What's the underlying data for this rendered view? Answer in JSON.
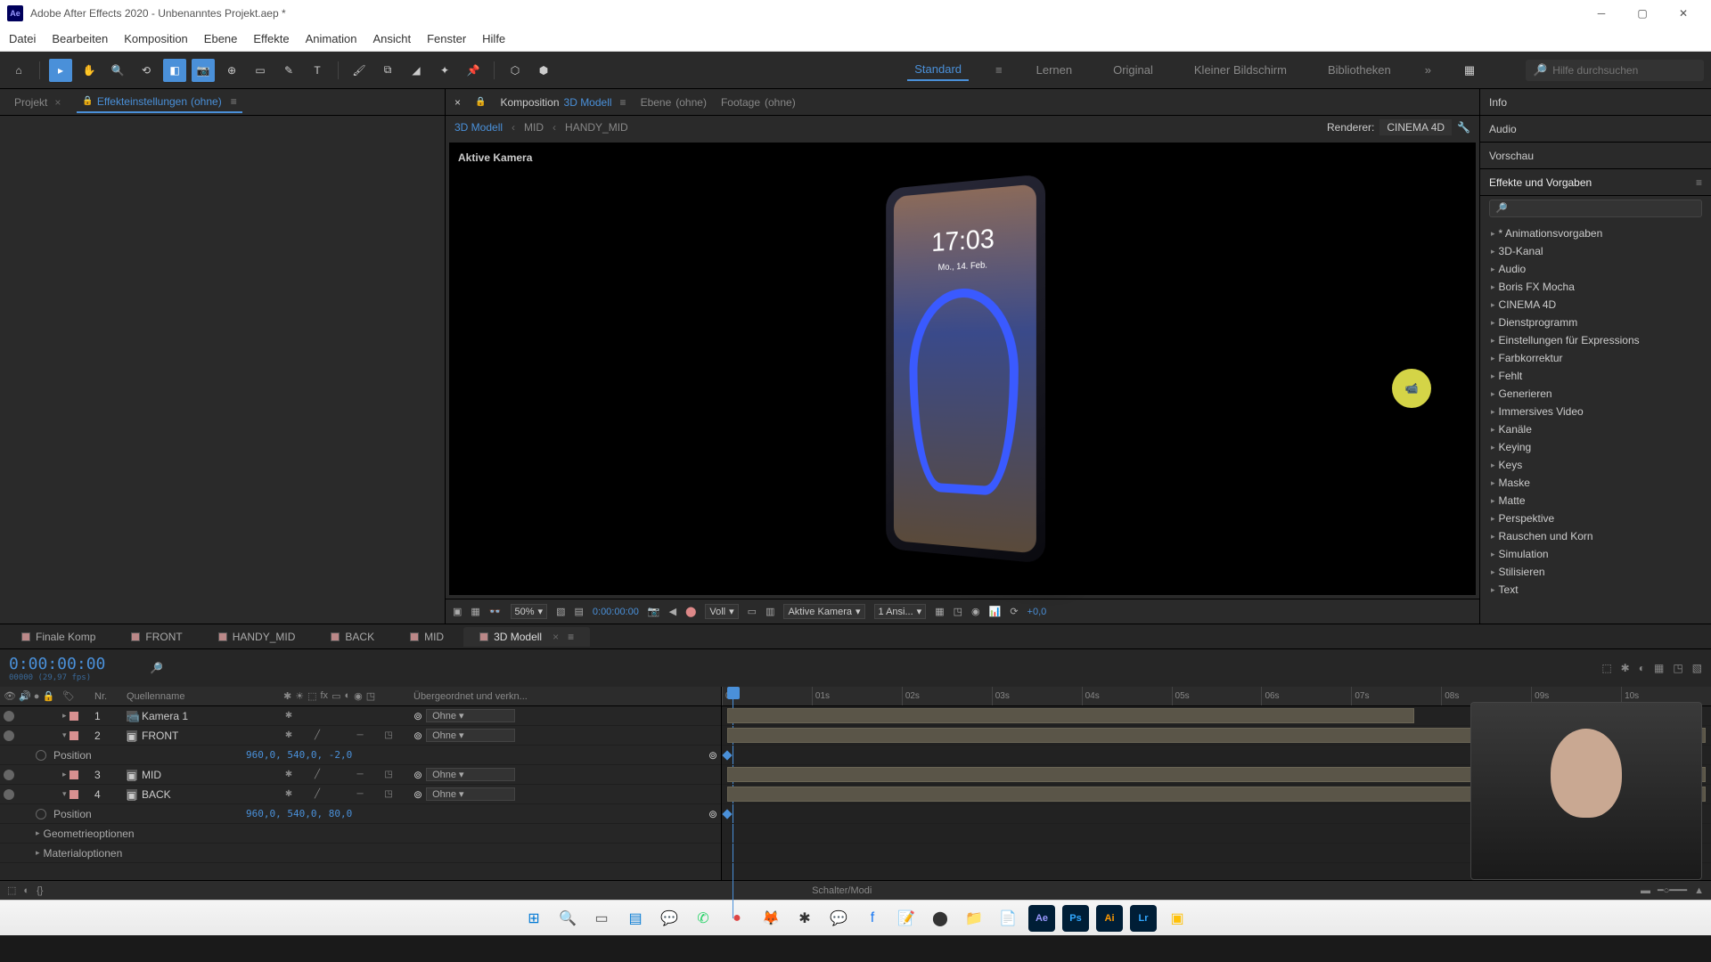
{
  "titlebar": {
    "app": "Adobe After Effects 2020",
    "project": "Unbenanntes Projekt.aep *"
  },
  "menu": [
    "Datei",
    "Bearbeiten",
    "Komposition",
    "Ebene",
    "Effekte",
    "Animation",
    "Ansicht",
    "Fenster",
    "Hilfe"
  ],
  "workspaces": {
    "items": [
      "Standard",
      "Lernen",
      "Original",
      "Kleiner Bildschirm",
      "Bibliotheken"
    ],
    "active": "Standard"
  },
  "search": {
    "placeholder": "Hilfe durchsuchen"
  },
  "left_panel": {
    "tabs": [
      {
        "label": "Projekt",
        "active": false
      },
      {
        "label": "Effekteinstellungen",
        "suffix": "(ohne)",
        "active": true,
        "locked": true
      }
    ]
  },
  "composition": {
    "tabs": [
      {
        "label": "Komposition",
        "sub": "3D Modell",
        "active": true,
        "locked": true
      },
      {
        "label": "Ebene",
        "sub": "(ohne)"
      },
      {
        "label": "Footage",
        "sub": "(ohne)"
      }
    ],
    "breadcrumb": [
      "3D Modell",
      "MID",
      "HANDY_MID"
    ],
    "renderer_label": "Renderer:",
    "renderer_value": "CINEMA 4D",
    "camera_label": "Aktive Kamera",
    "phone_time": "17:03",
    "phone_date": "Mo., 14. Feb.",
    "footer": {
      "zoom": "50%",
      "time": "0:00:00:00",
      "resolution": "Voll",
      "camera": "Aktive Kamera",
      "views": "1 Ansi...",
      "exposure": "+0,0"
    }
  },
  "right_panel": {
    "sections": [
      "Info",
      "Audio",
      "Vorschau",
      "Effekte und Vorgaben"
    ],
    "effects": [
      "* Animationsvorgaben",
      "3D-Kanal",
      "Audio",
      "Boris FX Mocha",
      "CINEMA 4D",
      "Dienstprogramm",
      "Einstellungen für Expressions",
      "Farbkorrektur",
      "Fehlt",
      "Generieren",
      "Immersives Video",
      "Kanäle",
      "Keying",
      "Keys",
      "Maske",
      "Matte",
      "Perspektive",
      "Rauschen und Korn",
      "Simulation",
      "Stilisieren",
      "Text"
    ]
  },
  "timeline": {
    "tabs": [
      "Finale Komp",
      "FRONT",
      "HANDY_MID",
      "BACK",
      "MID",
      "3D Modell"
    ],
    "active_tab": "3D Modell",
    "timecode": "0:00:00:00",
    "timecode_sub": "00000 (29,97 fps)",
    "columns": {
      "num": "Nr.",
      "name": "Quellenname",
      "parent": "Übergeordnet und verkn..."
    },
    "layers": [
      {
        "num": 1,
        "name": "Kamera 1",
        "type": "camera",
        "parent": "Ohne"
      },
      {
        "num": 2,
        "name": "FRONT",
        "type": "comp",
        "parent": "Ohne",
        "expanded": true,
        "props": [
          {
            "name": "Position",
            "value": "960,0, 540,0, -2,0"
          }
        ]
      },
      {
        "num": 3,
        "name": "MID",
        "type": "comp",
        "parent": "Ohne"
      },
      {
        "num": 4,
        "name": "BACK",
        "type": "comp",
        "parent": "Ohne",
        "expanded": true,
        "props": [
          {
            "name": "Position",
            "value": "960,0, 540,0, 80,0"
          },
          {
            "name": "Geometrieoptionen",
            "expandable": true
          },
          {
            "name": "Materialoptionen",
            "expandable": true
          }
        ]
      }
    ],
    "parent_none": "Ohne",
    "ruler": [
      "00s",
      "01s",
      "02s",
      "03s",
      "04s",
      "05s",
      "06s",
      "07s",
      "08s",
      "09s",
      "10s"
    ],
    "footer_switch": "Schalter/Modi"
  },
  "taskbar": {
    "icons": [
      {
        "name": "windows",
        "color": "#0078d4",
        "char": "⊞"
      },
      {
        "name": "search",
        "color": "#333",
        "char": "🔍"
      },
      {
        "name": "taskview",
        "color": "#555",
        "char": "▭"
      },
      {
        "name": "explorer",
        "color": "#0078d4",
        "char": "▤"
      },
      {
        "name": "teams",
        "color": "#6264a7",
        "char": "💬"
      },
      {
        "name": "whatsapp",
        "color": "#25d366",
        "char": "✆"
      },
      {
        "name": "app1",
        "color": "#d44",
        "char": "●"
      },
      {
        "name": "firefox",
        "color": "#ff9500",
        "char": "🦊"
      },
      {
        "name": "app2",
        "color": "#333",
        "char": "✱"
      },
      {
        "name": "messenger",
        "color": "#d946ef",
        "char": "💬"
      },
      {
        "name": "facebook",
        "color": "#1877f2",
        "char": "f"
      },
      {
        "name": "notes",
        "color": "#ffd54f",
        "char": "📝"
      },
      {
        "name": "obs",
        "color": "#333",
        "char": "⬤"
      },
      {
        "name": "files",
        "color": "#ffc107",
        "char": "📁"
      },
      {
        "name": "editor",
        "color": "#4fc3f7",
        "char": "📄"
      },
      {
        "name": "ae",
        "color": "#9999ff",
        "char": "Ae",
        "active": true
      },
      {
        "name": "ps",
        "color": "#31a8ff",
        "char": "Ps"
      },
      {
        "name": "ai",
        "color": "#ff9a00",
        "char": "Ai"
      },
      {
        "name": "lr",
        "color": "#31a8ff",
        "char": "Lr"
      },
      {
        "name": "app3",
        "color": "#ffc107",
        "char": "▣"
      }
    ]
  }
}
